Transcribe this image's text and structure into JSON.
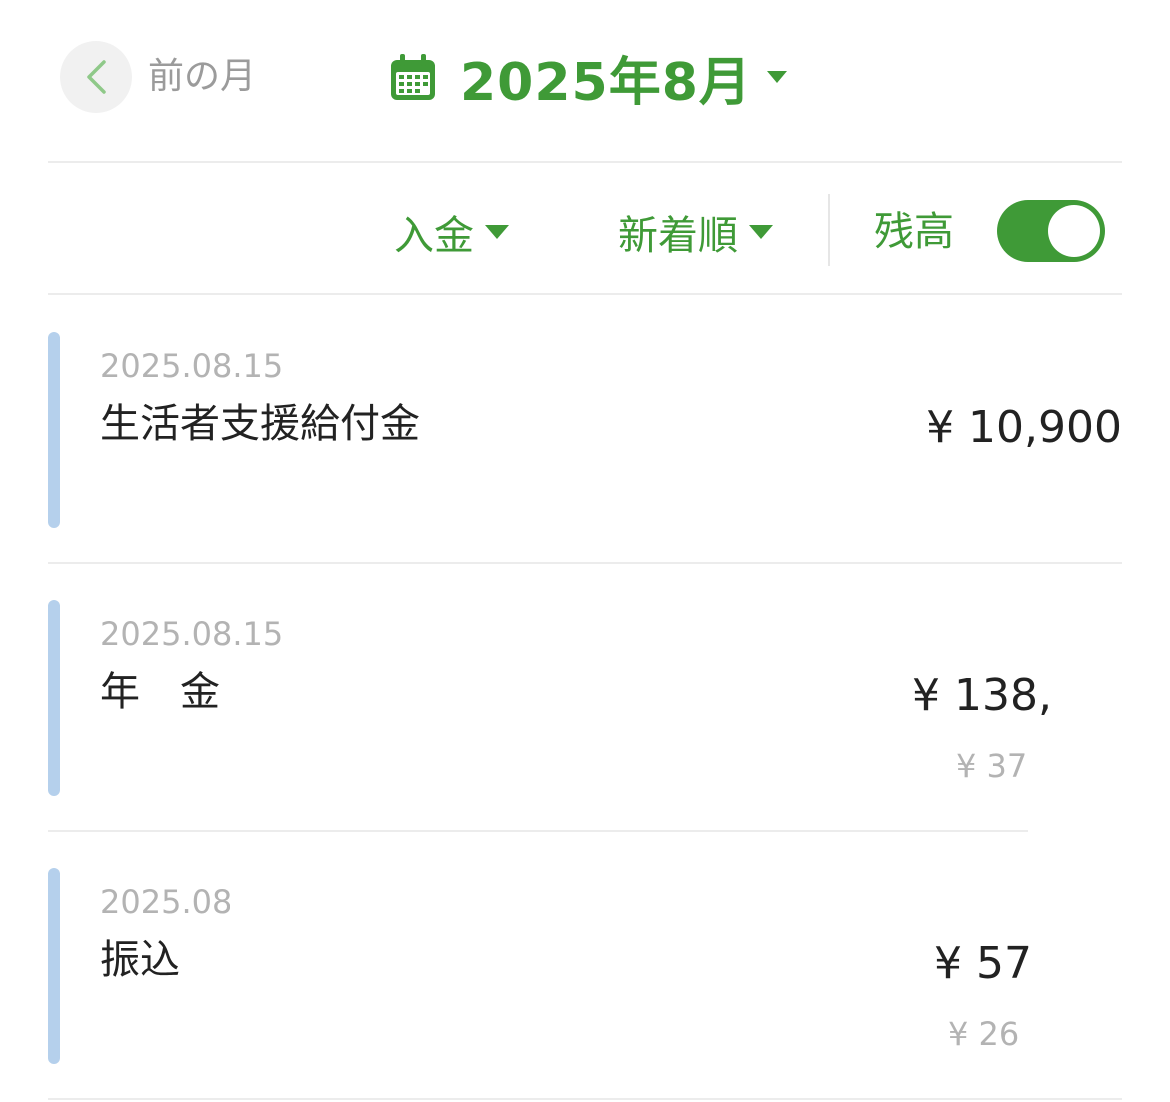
{
  "header": {
    "prev_label": "前の月",
    "prev_icon": "chevron-left-icon",
    "calendar_icon": "calendar-icon",
    "month": "2025年8月",
    "dropdown_icon": "caret-down-icon"
  },
  "filters": {
    "type": "入金",
    "sort": "新着順",
    "balance_label": "残高",
    "balance_on": true
  },
  "colors": {
    "accent": "#3f9a37",
    "row_marker": "#b5d0ec",
    "muted_text": "#b3b3b3"
  },
  "transactions": [
    {
      "date": "2025.08.15",
      "title": "生活者支援給付金",
      "amount": "¥ 10,900",
      "balance": ""
    },
    {
      "date": "2025.08.15",
      "title": "年　金",
      "amount": "¥ 138,",
      "balance": "¥ 37"
    },
    {
      "date": "2025.08",
      "title": "振込",
      "amount": "¥ 57",
      "balance": "¥ 26"
    }
  ]
}
